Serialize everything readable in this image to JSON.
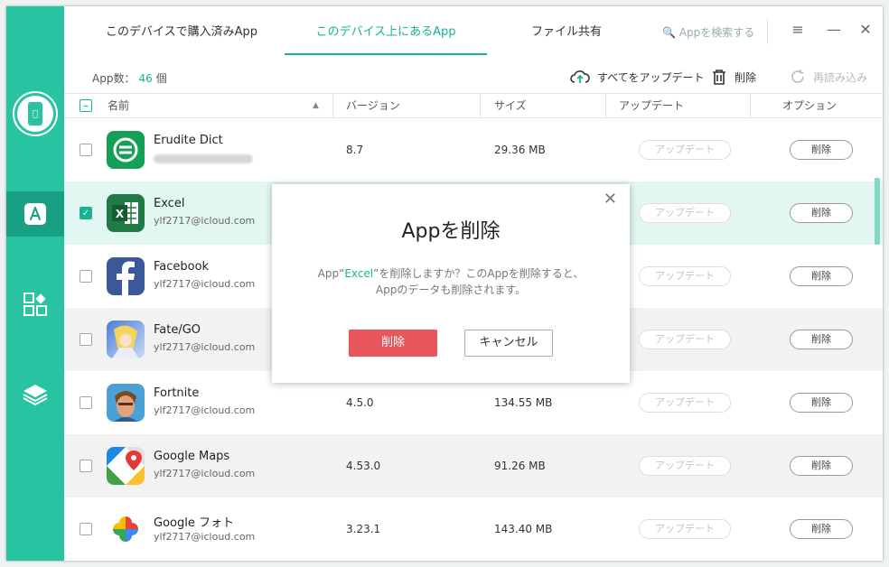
{
  "tabs": [
    {
      "label": "このデバイスで購入済みApp"
    },
    {
      "label": "このデバイス上にあるApp",
      "active": true
    },
    {
      "label": "ファイル共有"
    }
  ],
  "search": {
    "placeholder": "Appを検索する"
  },
  "toolbar": {
    "count_label": "App数：",
    "count_value": "46",
    "count_unit": "個",
    "update_all": "すべてをアップデート",
    "delete": "削除",
    "reload": "再読み込み"
  },
  "columns": {
    "name": "名前",
    "version": "バージョン",
    "size": "サイズ",
    "update": "アップデート",
    "option": "オプション"
  },
  "rows": [
    {
      "name": "Erudite Dict",
      "account": "",
      "version": "8.7",
      "size": "29.36 MB",
      "update": "アップデート",
      "delete": "削除",
      "checked": false
    },
    {
      "name": "Excel",
      "account": "ylf2717@icloud.com",
      "version": "",
      "size": "",
      "update": "アップデート",
      "delete": "削除",
      "checked": true
    },
    {
      "name": "Facebook",
      "account": "ylf2717@icloud.com",
      "version": "",
      "size": "",
      "update": "アップデート",
      "delete": "削除",
      "checked": false
    },
    {
      "name": "Fate/GO",
      "account": "ylf2717@icloud.com",
      "version": "",
      "size": "",
      "update": "アップデート",
      "delete": "削除",
      "checked": false
    },
    {
      "name": "Fortnite",
      "account": "ylf2717@icloud.com",
      "version": "4.5.0",
      "size": "134.55 MB",
      "update": "アップデート",
      "delete": "削除",
      "checked": false
    },
    {
      "name": "Google Maps",
      "account": "ylf2717@icloud.com",
      "version": "4.53.0",
      "size": "91.26 MB",
      "update": "アップデート",
      "delete": "削除",
      "checked": false
    },
    {
      "name": "Google フォト",
      "account": "ylf2717@icloud.com",
      "version": "3.23.1",
      "size": "143.40 MB",
      "update": "アップデート",
      "delete": "削除",
      "checked": false
    }
  ],
  "dialog": {
    "title": "Appを削除",
    "msg_prefix": "App“",
    "msg_app": "Excel",
    "msg_suffix": "”を削除しますか？このAppを削除すると、",
    "msg_line2": "Appのデータも削除されます。",
    "confirm": "削除",
    "cancel": "キャンセル"
  },
  "colors": {
    "accent": "#28c3a0",
    "accent_dark": "#17a083",
    "danger": "#e9575c"
  }
}
